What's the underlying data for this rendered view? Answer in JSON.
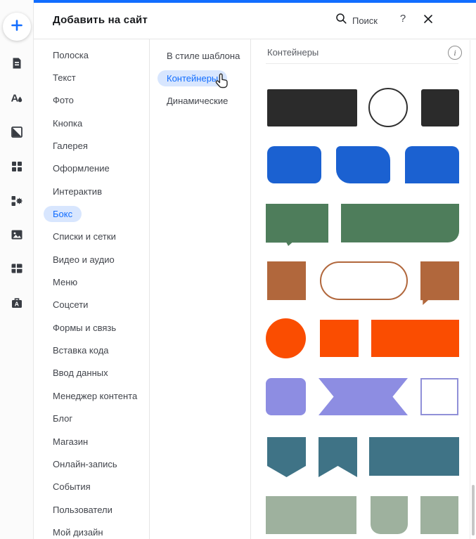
{
  "colors": {
    "accent": "#116dff",
    "selected_pill": "#d8e6fe",
    "topbar": "#116dff",
    "dark": "#2b2b2b",
    "blue": "#1b61d1",
    "green": "#4e7d5b",
    "brown": "#b1673c",
    "orange": "#fa4d01",
    "purple": "#8d8de2",
    "teal": "#3f7386",
    "sage": "#9eb19e"
  },
  "rail": {
    "icons": [
      {
        "name": "add-elements-plus-icon"
      },
      {
        "name": "page-document-icon"
      },
      {
        "name": "site-design-icon"
      },
      {
        "name": "media-contrast-icon"
      },
      {
        "name": "sections-grid-icon"
      },
      {
        "name": "app-market-gear-icon"
      },
      {
        "name": "media-image-icon"
      },
      {
        "name": "content-table-icon"
      },
      {
        "name": "hire-briefcase-icon"
      }
    ]
  },
  "header": {
    "title": "Добавить на сайт",
    "search_label": "Поиск",
    "help_label": "?"
  },
  "menu": {
    "items": [
      {
        "label": "Полоска",
        "selected": false
      },
      {
        "label": "Текст",
        "selected": false
      },
      {
        "label": "Фото",
        "selected": false
      },
      {
        "label": "Кнопка",
        "selected": false
      },
      {
        "label": "Галерея",
        "selected": false
      },
      {
        "label": "Оформление",
        "selected": false
      },
      {
        "label": "Интерактив",
        "selected": false
      },
      {
        "label": "Бокс",
        "selected": true
      },
      {
        "label": "Списки и сетки",
        "selected": false
      },
      {
        "label": "Видео и аудио",
        "selected": false
      },
      {
        "label": "Меню",
        "selected": false
      },
      {
        "label": "Соцсети",
        "selected": false
      },
      {
        "label": "Формы и связь",
        "selected": false
      },
      {
        "label": "Вставка кода",
        "selected": false
      },
      {
        "label": "Ввод данных",
        "selected": false
      },
      {
        "label": "Менеджер контента",
        "selected": false
      },
      {
        "label": "Блог",
        "selected": false
      },
      {
        "label": "Магазин",
        "selected": false
      },
      {
        "label": "Онлайн-запись",
        "selected": false
      },
      {
        "label": "События",
        "selected": false
      },
      {
        "label": "Пользователи",
        "selected": false
      },
      {
        "label": "Мой дизайн",
        "selected": false
      }
    ]
  },
  "submenu": {
    "items": [
      {
        "label": "В стиле шаблона",
        "selected": false
      },
      {
        "label": "Контейнеры",
        "selected": true
      },
      {
        "label": "Динамические",
        "selected": false
      }
    ]
  },
  "content": {
    "heading": "Контейнеры",
    "info_label": "i",
    "shapes": [
      {
        "name": "container-dark-rectangle",
        "color": "#2b2b2b",
        "variant": "fill"
      },
      {
        "name": "container-outline-circle",
        "color": "#2f2f2f",
        "variant": "outline"
      },
      {
        "name": "container-dark-square",
        "color": "#2b2b2b",
        "variant": "fill"
      },
      {
        "name": "container-blue-rounded-rectangle",
        "color": "#1b61d1",
        "variant": "fill"
      },
      {
        "name": "container-blue-asymmetric-rounded-rectangle",
        "color": "#1b61d1",
        "variant": "fill"
      },
      {
        "name": "container-blue-rectangle-rounded-top",
        "color": "#1b61d1",
        "variant": "fill"
      },
      {
        "name": "container-green-speech-rectangle",
        "color": "#4e7d5b",
        "variant": "fill"
      },
      {
        "name": "container-green-rectangle-rounded-corner",
        "color": "#4e7d5b",
        "variant": "fill"
      },
      {
        "name": "container-brown-square",
        "color": "#b1673c",
        "variant": "fill"
      },
      {
        "name": "container-brown-outline-pill",
        "color": "#b1673c",
        "variant": "outline"
      },
      {
        "name": "container-brown-speech-square",
        "color": "#b1673c",
        "variant": "fill"
      },
      {
        "name": "container-orange-circle",
        "color": "#fa4d01",
        "variant": "fill"
      },
      {
        "name": "container-orange-square",
        "color": "#fa4d01",
        "variant": "fill"
      },
      {
        "name": "container-orange-rectangle",
        "color": "#fa4d01",
        "variant": "fill"
      },
      {
        "name": "container-purple-rounded-square",
        "color": "#8d8de2",
        "variant": "fill"
      },
      {
        "name": "container-purple-ribbon",
        "color": "#8d8de2",
        "variant": "fill"
      },
      {
        "name": "container-purple-outline-square",
        "color": "#9090d8",
        "variant": "outline"
      },
      {
        "name": "container-teal-pennant",
        "color": "#3f7386",
        "variant": "fill"
      },
      {
        "name": "container-teal-bookmark",
        "color": "#3f7386",
        "variant": "fill"
      },
      {
        "name": "container-teal-rectangle",
        "color": "#3f7386",
        "variant": "fill"
      },
      {
        "name": "container-sage-rectangle",
        "color": "#9eb19e",
        "variant": "fill"
      },
      {
        "name": "container-sage-rounded-bottom-square",
        "color": "#9eb19e",
        "variant": "fill"
      },
      {
        "name": "container-sage-square",
        "color": "#9eb19e",
        "variant": "fill"
      }
    ]
  }
}
